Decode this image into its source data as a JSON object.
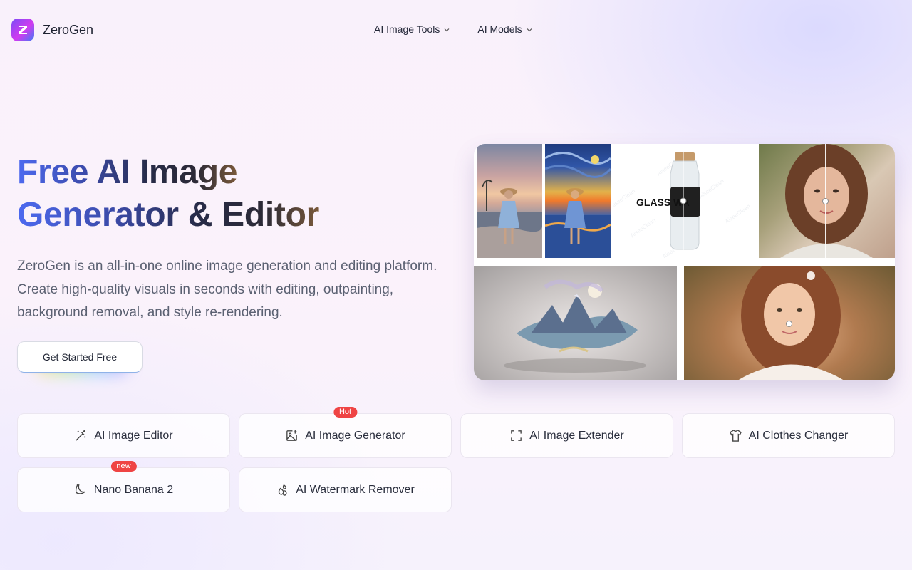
{
  "brand": {
    "name": "ZeroGen",
    "logo_letter": "Z",
    "accent": "#7a4cf6"
  },
  "nav": {
    "items": [
      {
        "label": "AI Image Tools",
        "icon": "chevron-down-icon"
      },
      {
        "label": "AI Models",
        "icon": "chevron-down-icon"
      }
    ]
  },
  "hero": {
    "title_line1": "Free AI Image",
    "title_line2": "Generator & Editor",
    "description": "ZeroGen is an all-in-one online image generation and editing platform. Create high-quality visuals in seconds with editing, outpainting, background removal, and style re-rendering.",
    "cta_label": "Get Started Free"
  },
  "gallery": {
    "bottle_label_text": "GLASS WA"
  },
  "tools": [
    {
      "label": "AI Image Editor",
      "icon": "magic-wand-icon",
      "badge": ""
    },
    {
      "label": "AI Image Generator",
      "icon": "image-plus-icon",
      "badge": "Hot"
    },
    {
      "label": "AI Image Extender",
      "icon": "expand-frame-icon",
      "badge": ""
    },
    {
      "label": "AI Clothes Changer",
      "icon": "shirt-icon",
      "badge": ""
    },
    {
      "label": "Nano Banana 2",
      "icon": "banana-icon",
      "badge": "new"
    },
    {
      "label": "AI Watermark Remover",
      "icon": "droplets-icon",
      "badge": ""
    }
  ]
}
